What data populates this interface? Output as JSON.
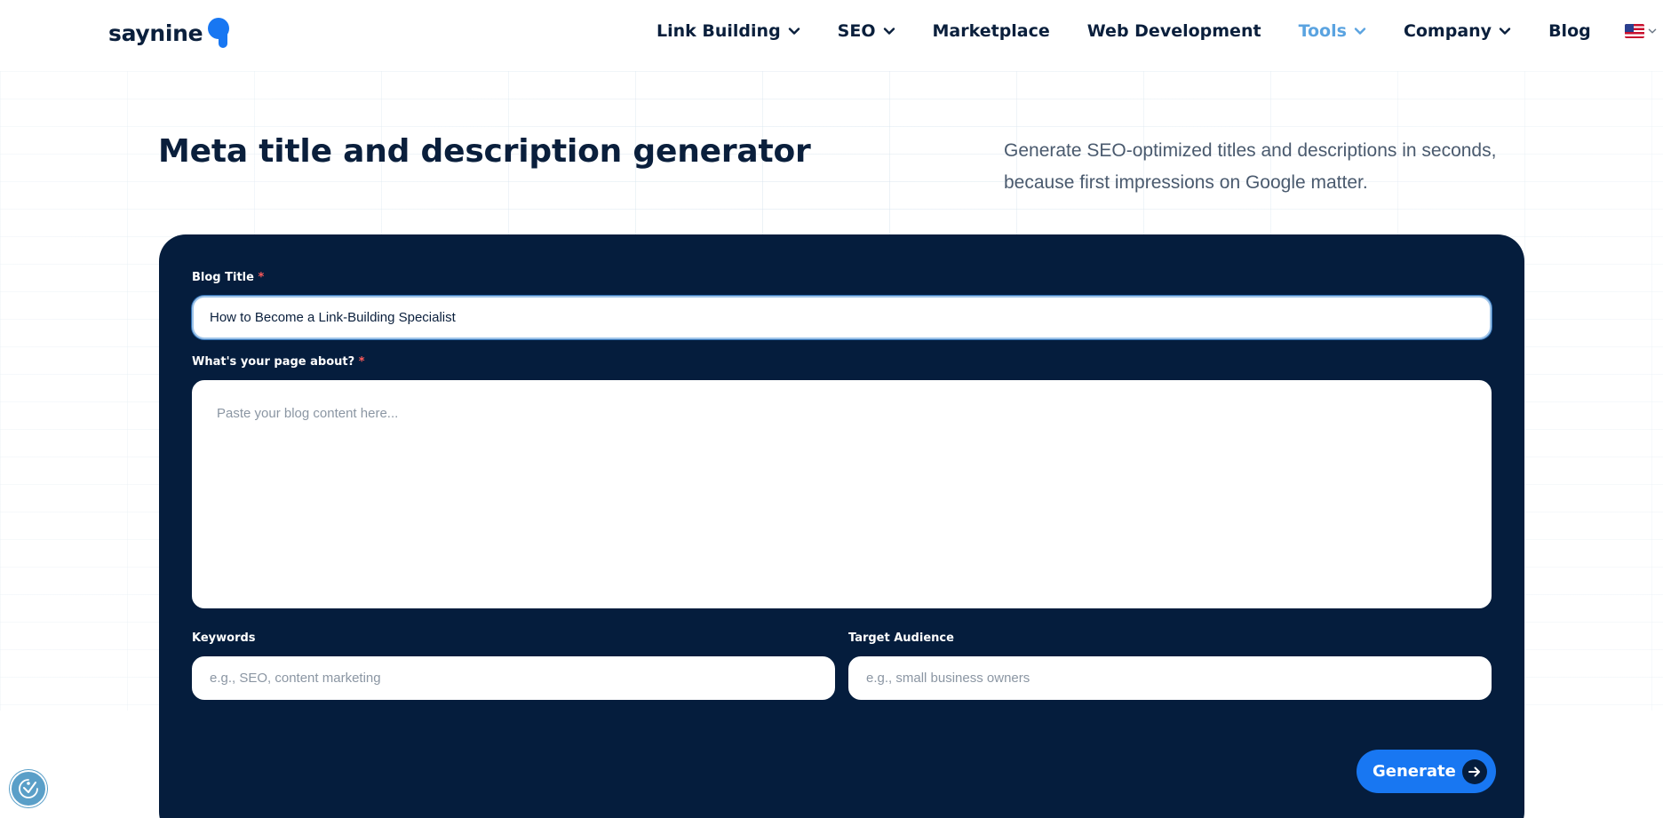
{
  "brand": {
    "name": "saynine"
  },
  "nav": {
    "items": [
      {
        "label": "Link Building",
        "has_dropdown": true,
        "active": false
      },
      {
        "label": "SEO",
        "has_dropdown": true,
        "active": false
      },
      {
        "label": "Marketplace",
        "has_dropdown": false,
        "active": false
      },
      {
        "label": "Web Development",
        "has_dropdown": false,
        "active": false
      },
      {
        "label": "Tools",
        "has_dropdown": true,
        "active": true
      },
      {
        "label": "Company",
        "has_dropdown": true,
        "active": false
      },
      {
        "label": "Blog",
        "has_dropdown": false,
        "active": false
      }
    ],
    "language_icon": "us-flag-icon"
  },
  "hero": {
    "title": "Meta title and description generator",
    "subtitle": "Generate SEO-optimized titles and descriptions in seconds, because first impressions on Google matter."
  },
  "form": {
    "blog_title": {
      "label": "Blog Title",
      "required_mark": "*",
      "value": "How to Become a Link-Building Specialist"
    },
    "page_about": {
      "label": "What's your page about?",
      "required_mark": "*",
      "placeholder": "Paste your blog content here..."
    },
    "keywords": {
      "label": "Keywords",
      "placeholder": "e.g., SEO, content marketing"
    },
    "target_audience": {
      "label": "Target Audience",
      "placeholder": "e.g., small business owners"
    },
    "generate_label": "Generate"
  },
  "colors": {
    "primary": "#1877f2",
    "navy": "#051d3d",
    "active_nav": "#5aa3e0",
    "required": "#ff5a5a"
  },
  "icons": {
    "accessibility": "accessibility-icon",
    "generate_arrow": "arrow-right-icon"
  }
}
